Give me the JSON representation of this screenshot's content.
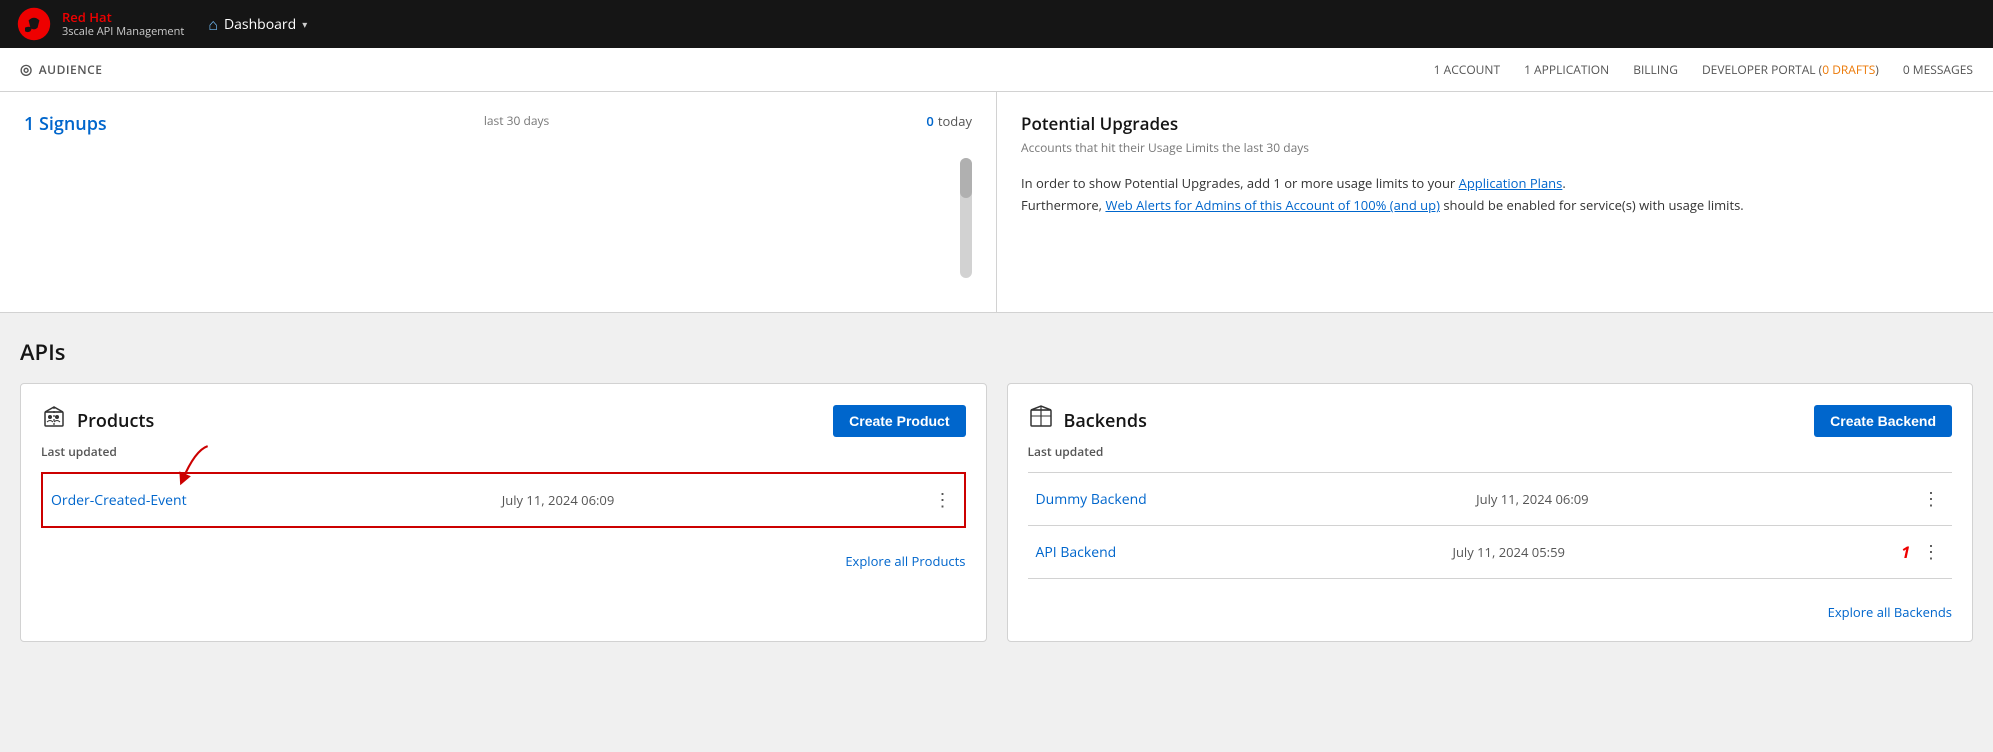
{
  "nav": {
    "brand_red_hat": "Red Hat",
    "brand_product": "3scale API Management",
    "dashboard_label": "Dashboard"
  },
  "audience_bar": {
    "label": "AUDIENCE",
    "nav_items": [
      {
        "key": "accounts",
        "label": "1 ACCOUNT"
      },
      {
        "key": "applications",
        "label": "1 APPLICATION"
      },
      {
        "key": "billing",
        "label": "BILLING"
      },
      {
        "key": "developer_portal",
        "label": "DEVELOPER PORTAL"
      },
      {
        "key": "drafts",
        "label": "0 DRAFTS"
      },
      {
        "key": "messages",
        "label": "0 MESSAGES"
      }
    ]
  },
  "signups": {
    "title": "1 Signups",
    "period": "last 30 days",
    "today_count": "0",
    "today_label": "today"
  },
  "potential_upgrades": {
    "title": "Potential Upgrades",
    "subtitle": "Accounts that hit their Usage Limits the last 30 days",
    "body_line1": "In order to show Potential Upgrades, add 1 or more usage limits to your",
    "application_plans_link": "Application Plans",
    "body_line1_end": ".",
    "body_line2": "Furthermore,",
    "web_alerts_link": "Web Alerts for Admins of this Account of 100% (and up)",
    "body_line2_end": "should be enabled for service(s) with usage limits."
  },
  "apis_section": {
    "title": "APIs",
    "products_card": {
      "icon": "📦",
      "title": "Products",
      "last_updated_label": "Last updated",
      "create_btn": "Create Product",
      "items": [
        {
          "name": "Order-Created-Event",
          "date": "July 11, 2024 06:09",
          "highlighted": true
        }
      ],
      "explore_all": "Explore all Products"
    },
    "backends_card": {
      "icon": "🗃",
      "title": "Backends",
      "last_updated_label": "Last updated",
      "create_btn": "Create Backend",
      "items": [
        {
          "name": "Dummy Backend",
          "date": "July 11, 2024 06:09",
          "has_alert": false
        },
        {
          "name": "API Backend",
          "date": "July 11, 2024 05:59",
          "has_alert": true,
          "alert_value": "1"
        }
      ],
      "explore_all": "Explore all Backends"
    }
  }
}
